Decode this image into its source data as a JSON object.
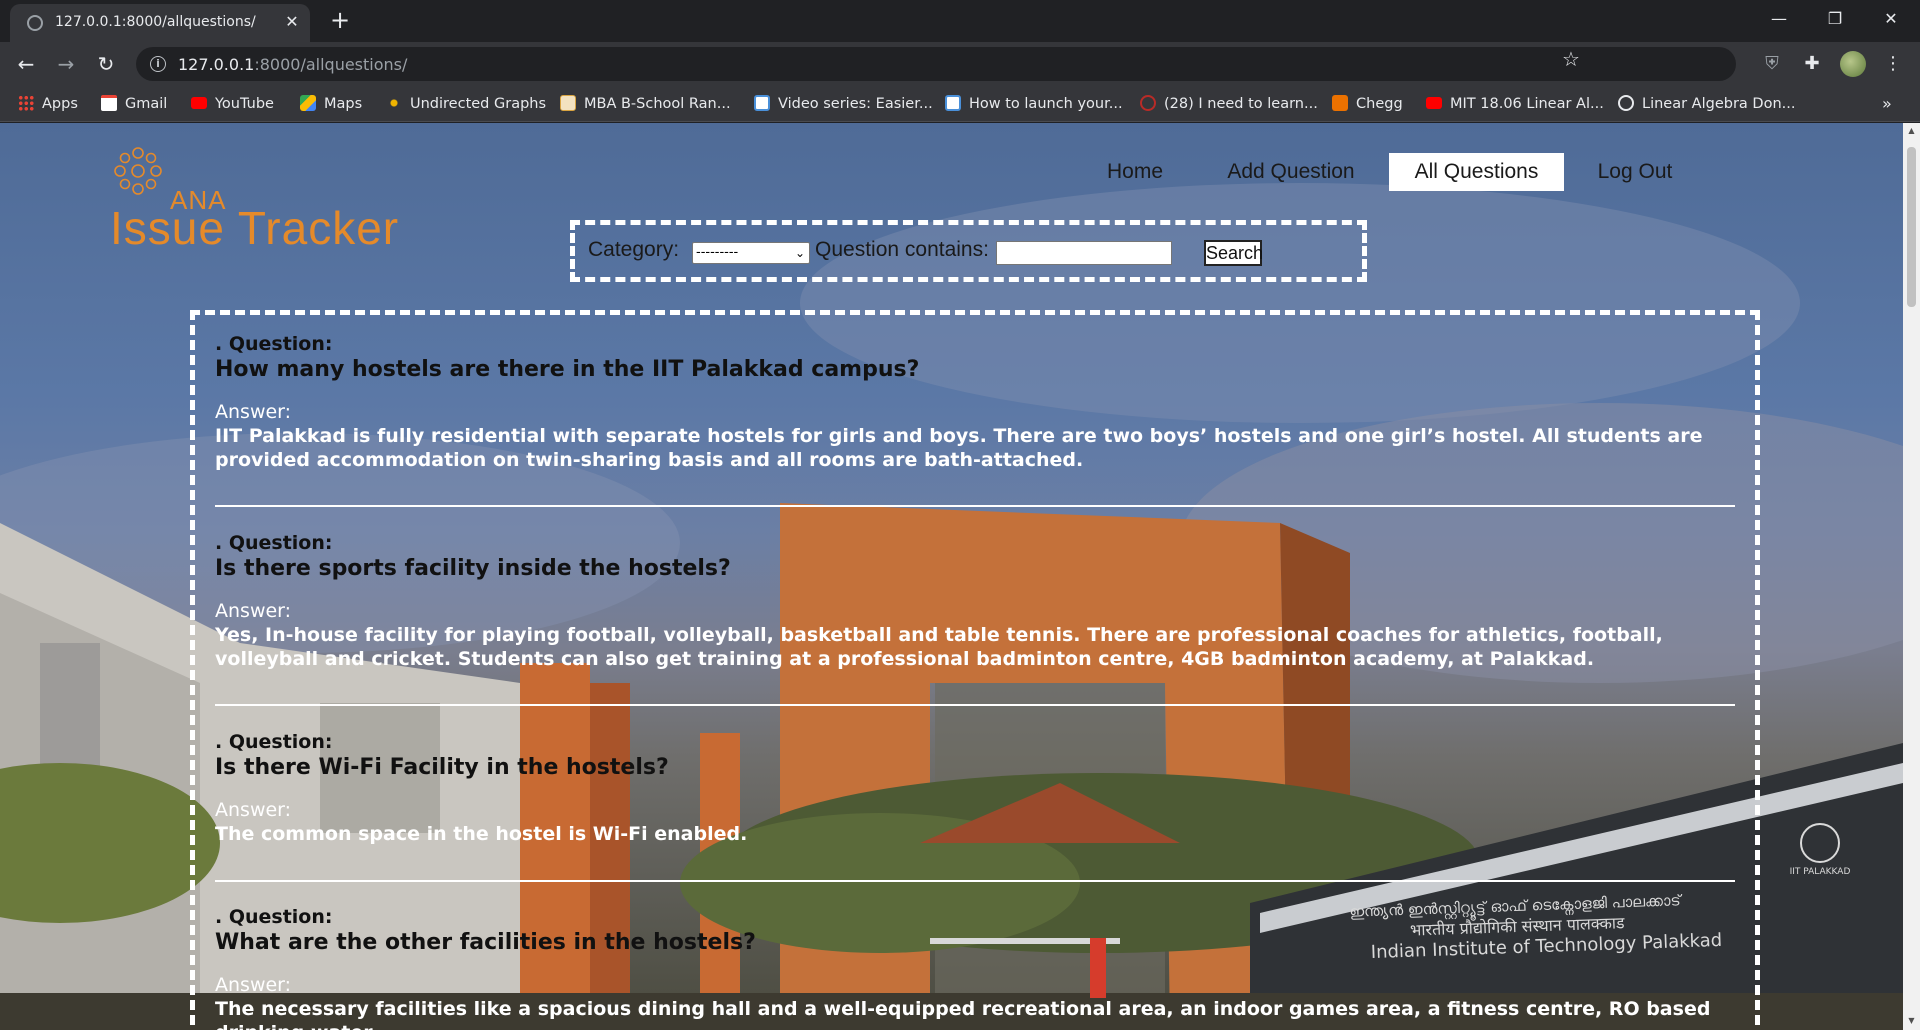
{
  "browser": {
    "tab_title": "127.0.0.1:8000/allquestions/",
    "url_host": "127.0.0.1",
    "url_path": ":8000/allquestions/",
    "bookmarks": [
      {
        "label": "Apps",
        "icon": "apps-grid-icon",
        "color": "#ea4335"
      },
      {
        "label": "Gmail",
        "icon": "gmail-icon",
        "color": "#ea4335"
      },
      {
        "label": "YouTube",
        "icon": "youtube-icon",
        "color": "#ff0000"
      },
      {
        "label": "Maps",
        "icon": "maps-icon",
        "color": "#34a853"
      },
      {
        "label": "Undirected Graphs",
        "icon": "graph-icon",
        "color": "#f0b400"
      },
      {
        "label": "MBA B-School Ran...",
        "icon": "bookmark-page-icon",
        "color": "#d9a441"
      },
      {
        "label": "Video series: Easier...",
        "icon": "doc-icon",
        "color": "#4a90d9"
      },
      {
        "label": "How to launch your...",
        "icon": "doc-icon",
        "color": "#4a90d9"
      },
      {
        "label": "(28) I need to learn...",
        "icon": "quora-icon",
        "color": "#b92b27"
      },
      {
        "label": "Chegg",
        "icon": "chegg-icon",
        "color": "#eb7100"
      },
      {
        "label": "MIT 18.06 Linear Al...",
        "icon": "youtube-icon",
        "color": "#ff0000"
      },
      {
        "label": "Linear Algebra Don...",
        "icon": "globe-icon",
        "color": "#e8eaed"
      }
    ]
  },
  "site": {
    "logo_small": "ANA",
    "logo_main": "Issue Tracker",
    "nav": [
      "Home",
      "Add Question",
      "All Questions",
      "Log Out"
    ],
    "active_nav": "All Questions",
    "brand_color": "#e58a2a"
  },
  "search": {
    "category_label": "Category:",
    "category_value": "---------",
    "question_label": "Question contains:",
    "question_value": "",
    "button_label": "Search"
  },
  "questions": [
    {
      "q_label": ". Question:",
      "question": "How many hostels are there in the IIT Palakkad campus?",
      "a_label": "Answer:",
      "answer": "IIT Palakkad is fully residential with separate hostels for girls and boys. There are two boys’ hostels and one girl’s hostel. All students are provided accommodation on twin-sharing basis and all rooms are bath-attached."
    },
    {
      "q_label": ". Question:",
      "question": "Is there sports facility inside the hostels?",
      "a_label": "Answer:",
      "answer": "Yes, In-house facility for playing football, volleyball, basketball and table tennis. There are professional coaches for athletics, football, volleyball and cricket. Students can also get training at a professional badminton centre, 4GB badminton academy, at Palakkad."
    },
    {
      "q_label": ". Question:",
      "question": "Is there Wi-Fi Facility in the hostels?",
      "a_label": "Answer:",
      "answer": "The common space in the hostel is Wi-Fi enabled."
    },
    {
      "q_label": ". Question:",
      "question": "What are the other facilities in the hostels?",
      "a_label": "Answer:",
      "answer": "The necessary facilities like a spacious dining hall and a well-equipped recreational area, an indoor games area, a fitness centre, RO based drinking water"
    }
  ],
  "background_signage": {
    "line1": "ഇന്ത്യൻ ഇൻസ്റ്റിറ്റ്യൂട്ട് ഓഫ് ടെക്നോളജി പാലക്കാട്",
    "line2": "भारतीय प्रौद्योगिकी संस्थान पालक्काड",
    "line3": "Indian Institute of Technology Palakkad",
    "emblem_text": "IIT PALAKKAD"
  }
}
